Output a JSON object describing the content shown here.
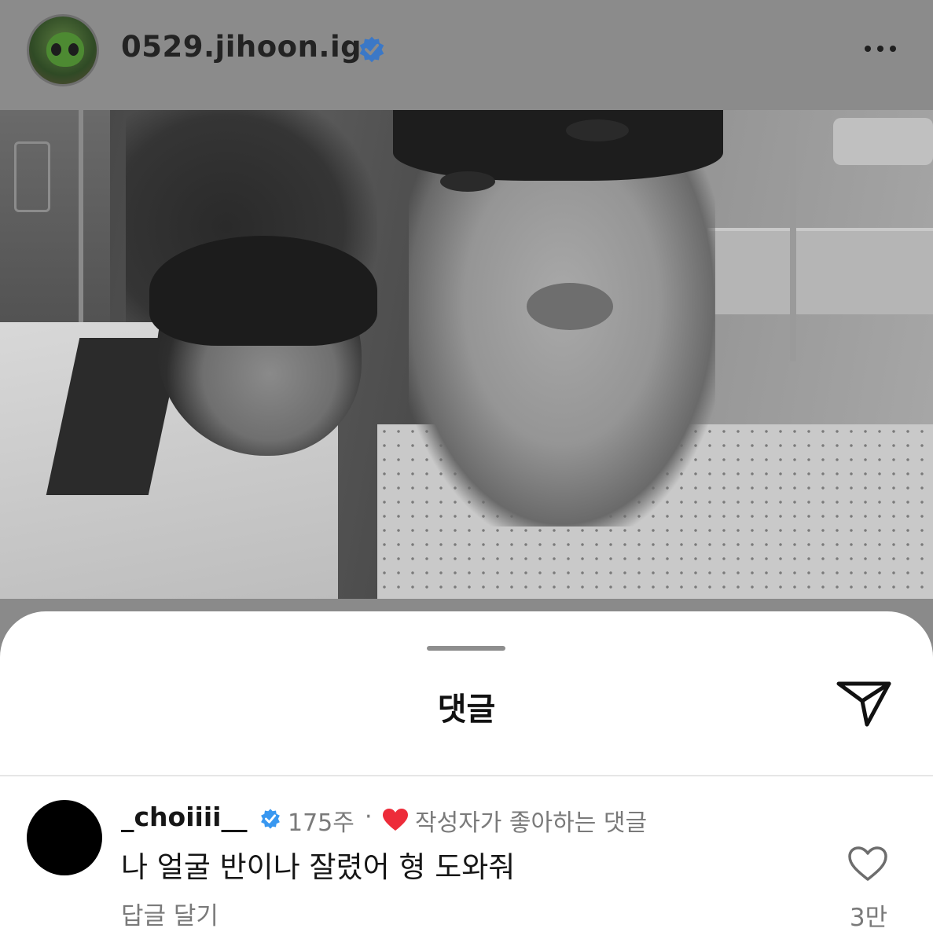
{
  "post": {
    "username": "0529.jihoon.ig",
    "avatar_icon": "alien-plush-icon",
    "verified_icon": "verified-badge-icon",
    "more_icon": "more-dots-icon"
  },
  "comments_sheet": {
    "title": "댓글",
    "send_icon": "paper-plane-icon"
  },
  "comment": {
    "username": "_choiiii__",
    "time": "175주",
    "separator": "·",
    "liked_by_author_label": "작성자가 좋아하는 댓글",
    "text": "나 얼굴 반이나 잘렸어 형 도와줘",
    "reply_label": "답글 달기",
    "like_count": "3만"
  },
  "colors": {
    "verified": "#3897f0",
    "heart": "#ed2c3a",
    "overlay": "#8a8a8a"
  }
}
